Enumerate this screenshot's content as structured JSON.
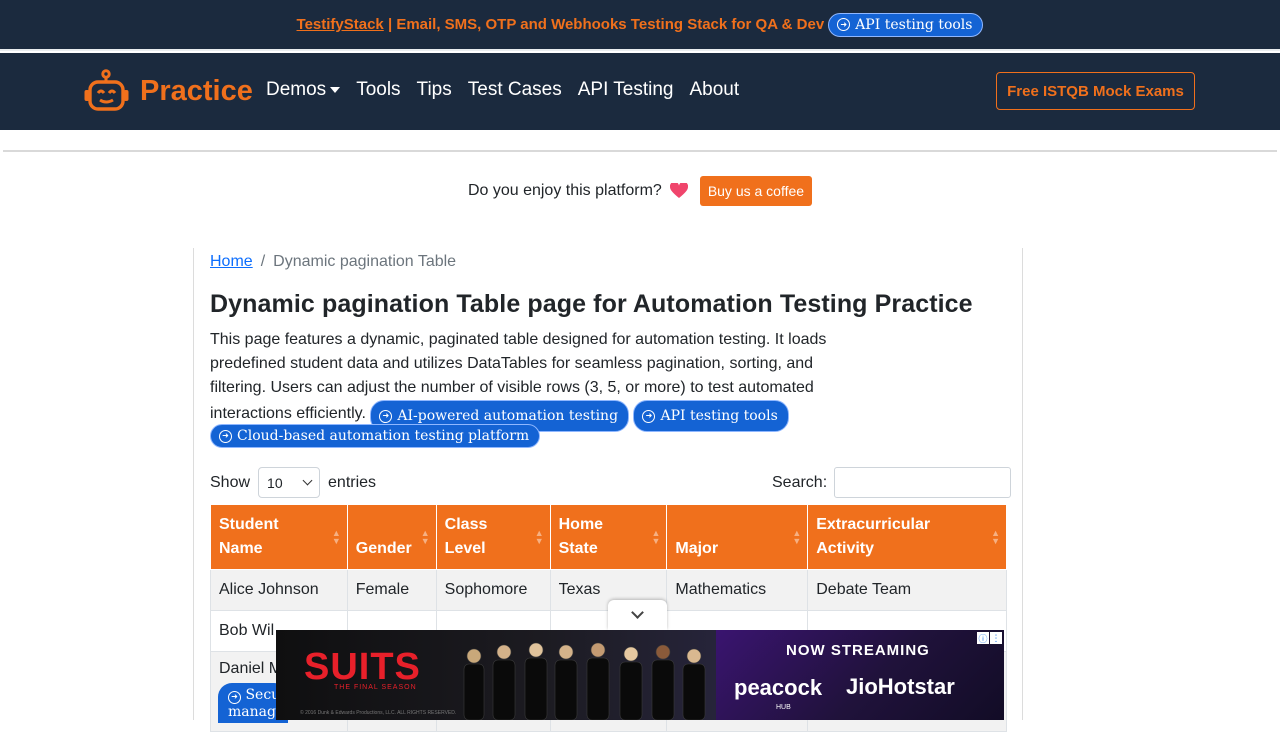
{
  "topbar": {
    "brand_link": "TestifyStack",
    "promo_text": " | Email, SMS, OTP and Webhooks Testing Stack for QA & Dev",
    "pill": "API testing tools"
  },
  "navbar": {
    "brand": "Practice",
    "links": [
      "Demos",
      "Tools",
      "Tips",
      "Test Cases",
      "API Testing",
      "About"
    ],
    "cta": "Free ISTQB Mock Exams"
  },
  "enjoy": {
    "text": "Do you enjoy this platform?",
    "button": "Buy us a coffee"
  },
  "breadcrumb": {
    "home": "Home",
    "separator": "/",
    "current": "Dynamic pagination Table"
  },
  "page": {
    "title": "Dynamic pagination Table page for Automation Testing Practice",
    "description": "This page features a dynamic, paginated table designed for automation testing. It loads predefined student data and utilizes DataTables for seamless pagination, sorting, and filtering. Users can adjust the number of visible rows (3, 5, or more) to test automated interactions efficiently.",
    "pills": [
      "AI-powered automation testing",
      "API testing tools",
      "Cloud-based automation testing platform"
    ]
  },
  "controls": {
    "show_label": "Show",
    "entries_value": "10",
    "entries_label": "entries",
    "search_label": "Search:",
    "search_value": ""
  },
  "table": {
    "headers": [
      {
        "line1": "Student",
        "line2": "Name"
      },
      {
        "line1": "",
        "line2": "Gender"
      },
      {
        "line1": "Class",
        "line2": "Level"
      },
      {
        "line1": "Home",
        "line2": "State"
      },
      {
        "line1": "",
        "line2": "Major"
      },
      {
        "line1": "Extracurricular",
        "line2": "Activity"
      }
    ],
    "rows": [
      [
        "Alice Johnson",
        "Female",
        "Sophomore",
        "Texas",
        "Mathematics",
        "Debate Team"
      ],
      [
        "Bob Wil",
        "",
        "",
        "",
        "",
        ""
      ],
      [
        "Daniel M",
        "",
        "",
        "",
        "",
        ""
      ]
    ],
    "row3_pill": [
      "Secu",
      "manage"
    ]
  },
  "ad": {
    "title": "SUITS",
    "subtitle": "THE FINAL SEASON",
    "copyright": "© 2016 Dunk & Edwards Productions, LLC. ALL RIGHTS RESERVED.",
    "streaming": "NOW STREAMING",
    "peacock": "peacock",
    "hub": "HUB",
    "jio": "JioHotstar"
  },
  "colors": {
    "accent": "#f0701c",
    "navy": "#1b2a3e",
    "pill": "#1463d4",
    "link": "#0d6efd"
  }
}
